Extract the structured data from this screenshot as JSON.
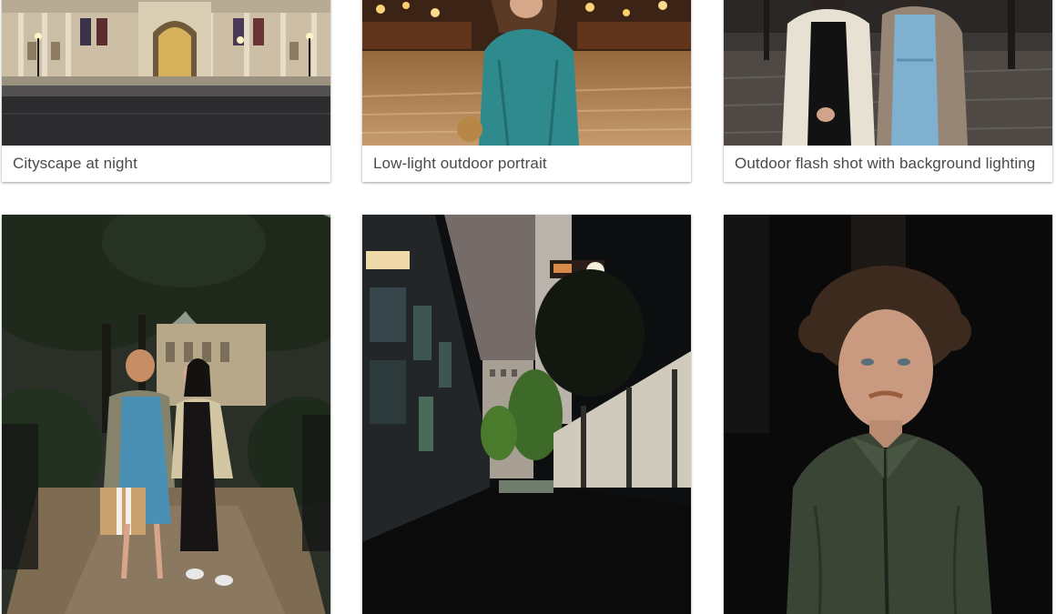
{
  "gallery": {
    "cards": [
      {
        "caption": "Cityscape at night",
        "photo": "cityscape-night-photo"
      },
      {
        "caption": "Low-light outdoor portrait",
        "photo": "low-light-portrait-photo"
      },
      {
        "caption": "Outdoor flash shot with background lighting",
        "photo": "outdoor-flash-photo"
      },
      {
        "caption": "",
        "photo": "two-women-garden-photo"
      },
      {
        "caption": "",
        "photo": "dark-alley-photo"
      },
      {
        "caption": "",
        "photo": "man-portrait-night-photo"
      }
    ]
  },
  "colors": {
    "caption_text": "#4a4a4a",
    "card_background": "#ffffff",
    "page_background": "#ffffff"
  }
}
